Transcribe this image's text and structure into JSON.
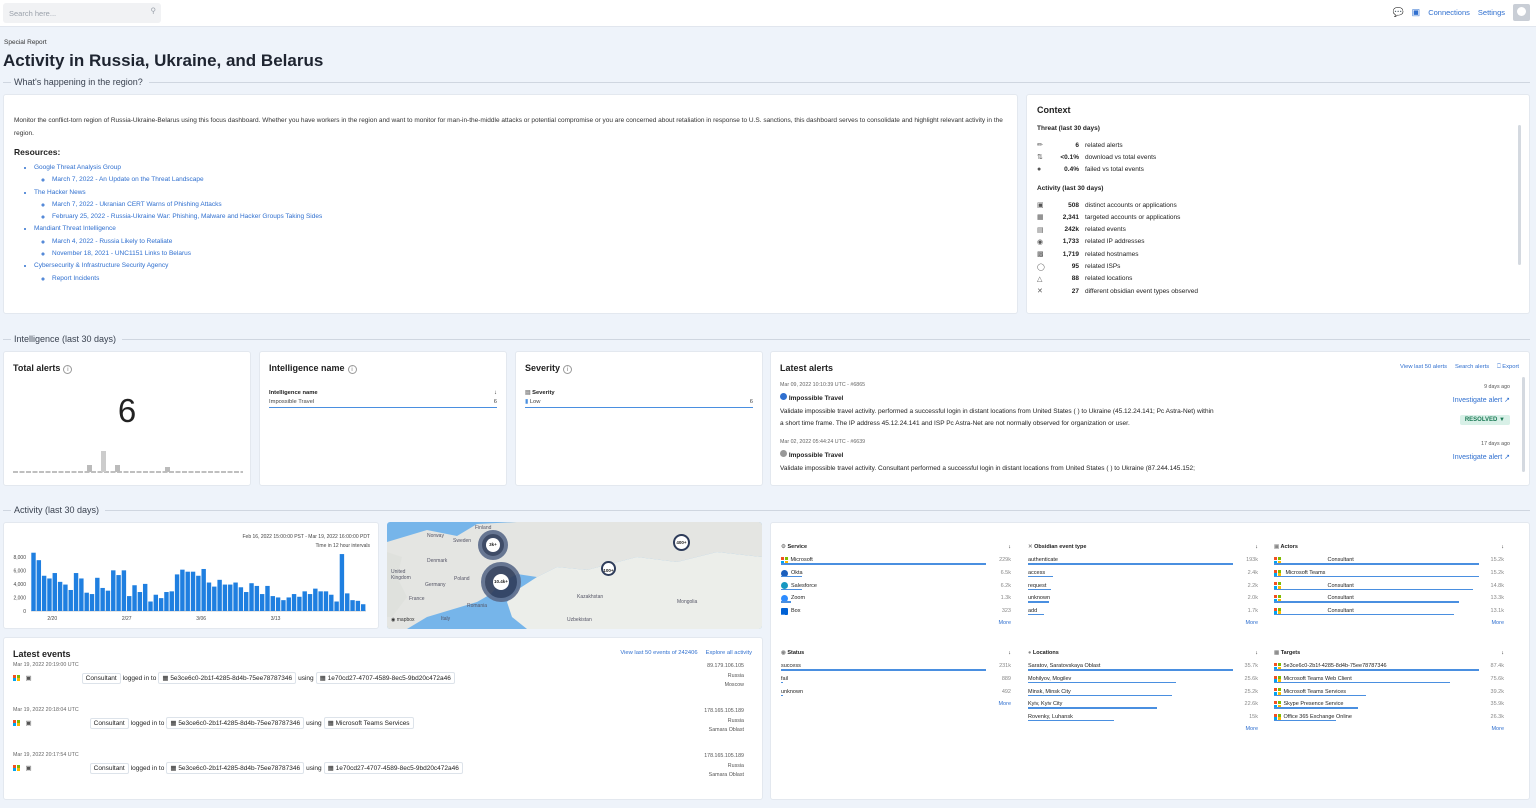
{
  "topbar": {
    "search_placeholder": "Search here...",
    "connections": "Connections",
    "settings": "Settings"
  },
  "header": {
    "eyebrow": "Special Report",
    "title": "Activity in Russia, Ukraine, and Belarus",
    "section1": "What's happening in the region?",
    "section2": "Intelligence (last 30 days)",
    "section3": "Activity (last 30 days)"
  },
  "intro": {
    "text": "Monitor the conflict-torn region of Russia-Ukraine-Belarus using this focus dashboard. Whether you have workers in the region and want to monitor for man-in-the-middle attacks or potential compromise or you are concerned about retaliation in response to U.S. sanctions, this dashboard serves to consolidate and highlight relevant activity in the region.",
    "resources_title": "Resources:",
    "resources": [
      {
        "label": "Google Threat Analysis Group",
        "links": [
          "March 7, 2022 - An Update on the Threat Landscape"
        ]
      },
      {
        "label": "The Hacker News",
        "links": [
          "March 7, 2022 - Ukranian CERT Warns of Phishing Attacks",
          "February 25, 2022 - Russia-Ukraine War: Phishing, Malware and Hacker Groups Taking Sides"
        ]
      },
      {
        "label": "Mandiant Threat Intelligence",
        "links": [
          "March 4, 2022 - Russia Likely to Retaliate",
          "November 18, 2021 - UNC1151 Links to Belarus"
        ]
      },
      {
        "label": "Cybersecurity & Infrastructure Security Agency",
        "links": [
          "Report Incidents"
        ]
      }
    ]
  },
  "context": {
    "title": "Context",
    "threat_title": "Threat (last 30 days)",
    "threat": [
      {
        "v": "6",
        "t": "related alerts"
      },
      {
        "v": "<0.1%",
        "t": "download vs total events"
      },
      {
        "v": "0.4%",
        "t": "failed vs total events"
      }
    ],
    "activity_title": "Activity (last 30 days)",
    "activity": [
      {
        "v": "508",
        "t": "distinct accounts or applications"
      },
      {
        "v": "2,341",
        "t": "targeted accounts or applications"
      },
      {
        "v": "242k",
        "t": "related events"
      },
      {
        "v": "1,733",
        "t": "related IP addresses"
      },
      {
        "v": "1,719",
        "t": "related hostnames"
      },
      {
        "v": "95",
        "t": "related ISPs"
      },
      {
        "v": "88",
        "t": "related locations"
      },
      {
        "v": "27",
        "t": "different obsidian event types observed"
      }
    ]
  },
  "total_alerts": {
    "title": "Total alerts",
    "value": "6"
  },
  "intel_name": {
    "title": "Intelligence name",
    "col": "Intelligence name",
    "row": "Impossible Travel",
    "count": "6"
  },
  "severity": {
    "title": "Severity",
    "col": "Severity",
    "row": "Low",
    "count": "6"
  },
  "latest_alerts": {
    "title": "Latest alerts",
    "view": "View last 50 alerts",
    "search": "Search alerts",
    "export": "Export",
    "items": [
      {
        "meta": "Mar 09, 2022 10:10:39 UTC - #6865",
        "name": "Impossible Travel",
        "text1": "Validate impossible travel activity.                              performed a successful login in distant locations from United States (                                                                             ) to Ukraine (45.12.24.141; Pc Astra-Net) within",
        "text2": "a short time frame. The IP address 45.12.24.141 and ISP Pc Astra-Net are not normally observed for organization or user.",
        "ago": "9 days ago",
        "invest": "Investigate alert",
        "status": "RESOLVED"
      },
      {
        "meta": "Mar 02, 2022 05:44:24 UTC - #6639",
        "name": "Impossible Travel",
        "text1": "Validate impossible travel activity.                              Consultant performed a successful login in distant locations from United States (                                    ) to Ukraine (87.244.145.152;",
        "ago": "17 days ago",
        "invest": "Investigate alert"
      }
    ]
  },
  "activity_chart": {
    "range": "Feb 16, 2022 15:00:00 PST - Mar 19, 2022 16:00:00 PDT",
    "interval": "Time in 12 hour intervals"
  },
  "chart_data": {
    "type": "bar",
    "ylim": [
      0,
      9000
    ],
    "yticks": [
      "8,000",
      "6,000",
      "4,000",
      "2,000",
      "0"
    ],
    "xticks": [
      "2/20",
      "2/27",
      "3/06",
      "3/13"
    ],
    "values": [
      8600,
      7500,
      5200,
      4800,
      5600,
      4300,
      3900,
      3100,
      5600,
      4800,
      2700,
      2500,
      4900,
      3400,
      3000,
      6000,
      5300,
      6000,
      2200,
      3800,
      2800,
      4000,
      1400,
      2400,
      1900,
      2800,
      2900,
      5400,
      6100,
      5800,
      5800,
      5200,
      6200,
      4200,
      3600,
      4600,
      3900,
      3900,
      4200,
      3500,
      2800,
      4100,
      3700,
      2500,
      3700,
      2200,
      2000,
      1600,
      2000,
      2500,
      2100,
      2900,
      2500,
      3300,
      2900,
      2900,
      2400,
      1400,
      8400,
      2600,
      1600,
      1500,
      1000
    ]
  },
  "map": {
    "labels": [
      "Norway",
      "Finland",
      "Sweden",
      "Denmark",
      "United Kingdom",
      "Germany",
      "Poland",
      "France",
      "Romania",
      "Italy",
      "Kazakhstan",
      "Mongolia",
      "Uzbekistan",
      "Russia"
    ],
    "bubbles": [
      "3k+",
      "600+",
      "100+",
      "10.4k+",
      "400+"
    ],
    "attribution": "mapbox"
  },
  "latest_events": {
    "title": "Latest events",
    "view": "View last 50 events of 242406",
    "explore": "Explore all activity",
    "items": [
      {
        "time": "Mar 19, 2022 20:19:00 UTC",
        "user": "Consultant",
        "verb": "logged in to",
        "target": "5e3ce6c0-2b1f-4285-8d4b-75ee78787346",
        "using": "using",
        "app": "1e70cd27-4707-4589-8ec5-9bd20c472a46",
        "ip": "89.179.106.105",
        "country": "Russia",
        "city": "Moscow"
      },
      {
        "time": "Mar 19, 2022 20:18:04 UTC",
        "user": "Consultant",
        "verb": "logged in to",
        "target": "5e3ce6c0-2b1f-4285-8d4b-75ee78787346",
        "using": "using",
        "app": "Microsoft Teams Services",
        "ip": "178.165.105.189",
        "country": "Russia",
        "city": "Samara Oblast"
      },
      {
        "time": "Mar 19, 2022 20:17:54 UTC",
        "user": "Consultant",
        "verb": "logged in to",
        "target": "5e3ce6c0-2b1f-4285-8d4b-75ee78787346",
        "using": "using",
        "app": "1e70cd27-4707-4589-8ec5-9bd20c472a46",
        "ip": "178.165.105.189",
        "country": "Russia",
        "city": "Samara Oblast"
      }
    ]
  },
  "stats": {
    "more": "More",
    "service": {
      "title": "Service",
      "rows": [
        {
          "l": "Microsoft",
          "v": "229k",
          "f": 1
        },
        {
          "l": "Okta",
          "v": "6.5k",
          "f": 0.1
        },
        {
          "l": "Salesforce",
          "v": "6.2k",
          "f": 0.1
        },
        {
          "l": "Zoom",
          "v": "1.3k",
          "f": 0.05
        },
        {
          "l": "Box",
          "v": "323",
          "f": 0.02
        }
      ]
    },
    "event_type": {
      "title": "Obsidian event type",
      "rows": [
        {
          "l": "authenticate",
          "v": "193k",
          "f": 1
        },
        {
          "l": "access",
          "v": "2.4k",
          "f": 0.12
        },
        {
          "l": "request",
          "v": "2.2k",
          "f": 0.11
        },
        {
          "l": "unknown",
          "v": "2.0k",
          "f": 0.1
        },
        {
          "l": "add",
          "v": "1.7k",
          "f": 0.08
        }
      ]
    },
    "actors": {
      "title": "Actors",
      "rows": [
        {
          "l": "Consultant",
          "v": "15.2k",
          "f": 1
        },
        {
          "l": "Microsoft Teams",
          "v": "15.2k",
          "f": 1
        },
        {
          "l": "Consultant",
          "v": "14.8k",
          "f": 0.97
        },
        {
          "l": "Consultant",
          "v": "13.3k",
          "f": 0.9
        },
        {
          "l": "Consultant",
          "v": "13.1k",
          "f": 0.88
        }
      ]
    },
    "status": {
      "title": "Status",
      "rows": [
        {
          "l": "success",
          "v": "231k",
          "f": 1
        },
        {
          "l": "fail",
          "v": "889",
          "f": 0.01
        },
        {
          "l": "unknown",
          "v": "492",
          "f": 0.01
        }
      ]
    },
    "locations": {
      "title": "Locations",
      "rows": [
        {
          "l": "Saratov, Saratovskaya Oblast",
          "v": "35.7k",
          "f": 1
        },
        {
          "l": "Mohilyov, Mogilev",
          "v": "25.6k",
          "f": 0.72
        },
        {
          "l": "Minsk, Minsk City",
          "v": "25.2k",
          "f": 0.7
        },
        {
          "l": "Kyiv, Kyiv City",
          "v": "22.6k",
          "f": 0.63
        },
        {
          "l": "Rovenky, Luhansk",
          "v": "15k",
          "f": 0.42
        }
      ]
    },
    "targets": {
      "title": "Targets",
      "rows": [
        {
          "l": "5e3ce6c0-2b1f-4285-8d4b-75ee78787346",
          "v": "87.4k",
          "f": 1
        },
        {
          "l": "Microsoft Teams Web Client",
          "v": "75.6k",
          "f": 0.86
        },
        {
          "l": "Microsoft Teams Services",
          "v": "39.2k",
          "f": 0.45
        },
        {
          "l": "Skype Presence Service",
          "v": "35.9k",
          "f": 0.41
        },
        {
          "l": "Office 365 Exchange Online",
          "v": "26.3k",
          "f": 0.3
        }
      ]
    }
  }
}
